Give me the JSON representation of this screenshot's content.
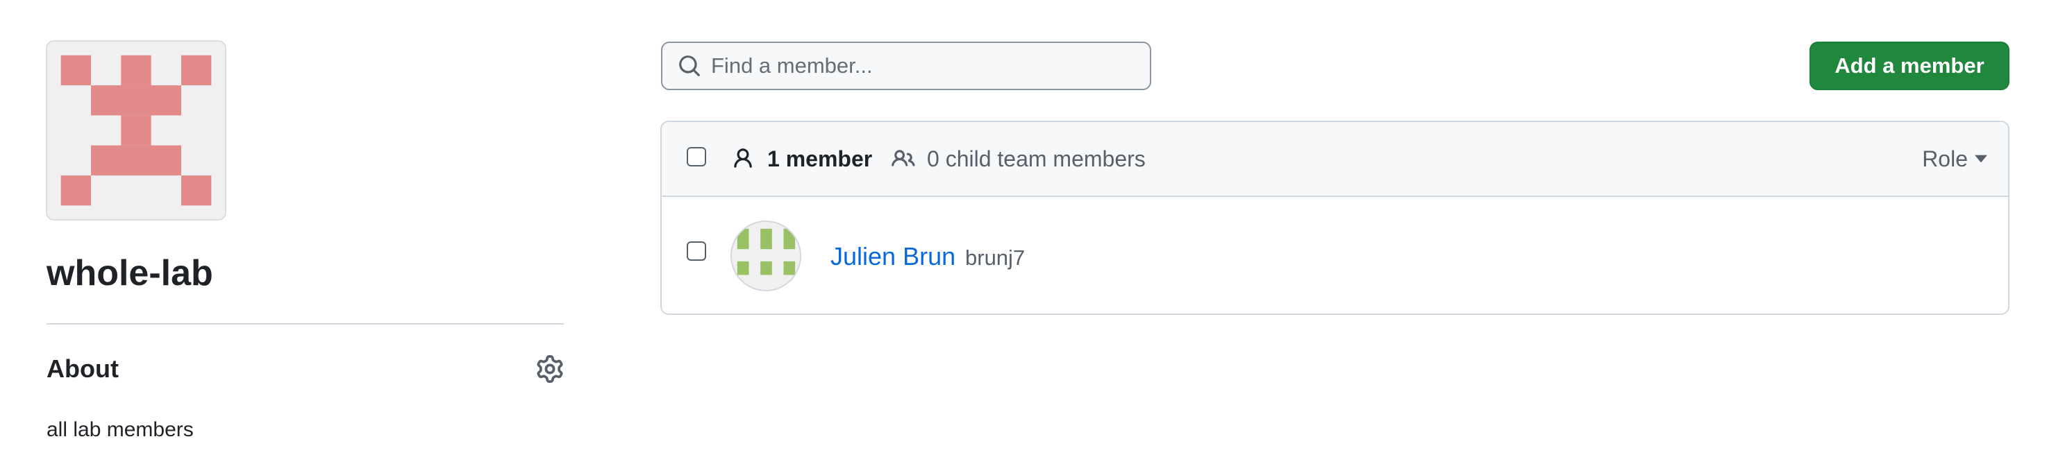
{
  "team": {
    "name": "whole-lab",
    "avatar_color": "#e38a8b",
    "avatar_bg": "#f0f0f0"
  },
  "about": {
    "title": "About",
    "description": "all lab members",
    "settings_icon": "gear-icon"
  },
  "search": {
    "placeholder": "Find a member...",
    "value": "",
    "icon": "search-icon"
  },
  "add_member_button": {
    "label": "Add a member",
    "color": "#1f883d"
  },
  "member_list": {
    "header": {
      "member_count_label": "1 member",
      "child_team_label": "0 child team members",
      "role_filter_label": "Role"
    },
    "members": [
      {
        "name": "Julien Brun",
        "login": "brunj7",
        "avatar_color": "#98c164"
      }
    ]
  },
  "colors": {
    "link": "#0969da",
    "muted_text": "#57606a",
    "border": "#d0d7de",
    "header_bg": "#f6f8fa"
  }
}
